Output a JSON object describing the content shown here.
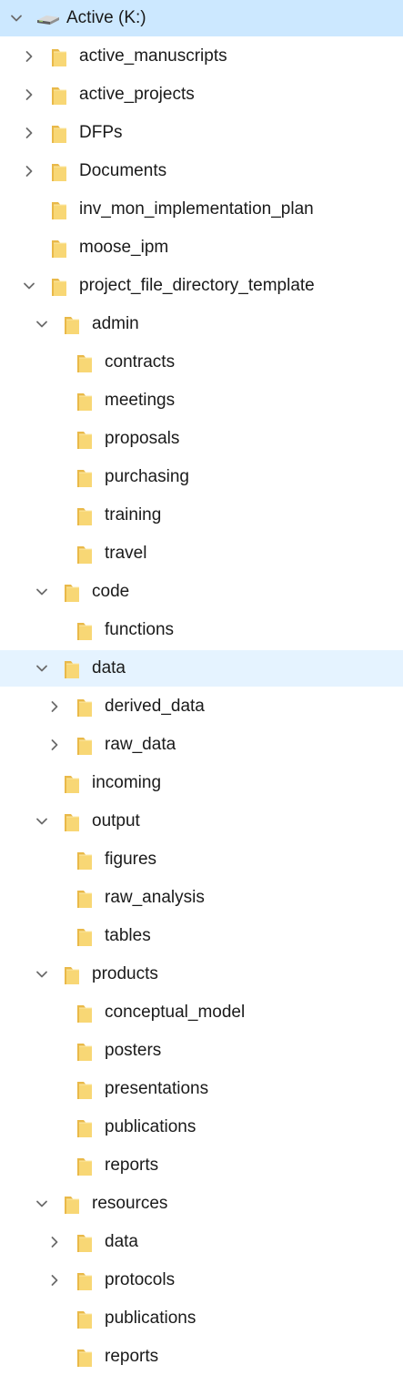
{
  "tree": [
    {
      "label": "Active (K:)",
      "icon": "drive-icon",
      "chevron": "expanded",
      "level": 0,
      "state": "selected"
    },
    {
      "label": "active_manuscripts",
      "icon": "folder-icon",
      "chevron": "collapsed",
      "level": 1
    },
    {
      "label": "active_projects",
      "icon": "folder-icon",
      "chevron": "collapsed",
      "level": 1
    },
    {
      "label": "DFPs",
      "icon": "folder-icon",
      "chevron": "collapsed",
      "level": 1
    },
    {
      "label": "Documents",
      "icon": "folder-icon",
      "chevron": "collapsed",
      "level": 1
    },
    {
      "label": "inv_mon_implementation_plan",
      "icon": "folder-icon",
      "chevron": "none",
      "level": 1
    },
    {
      "label": "moose_ipm",
      "icon": "folder-icon",
      "chevron": "none",
      "level": 1
    },
    {
      "label": "project_file_directory_template",
      "icon": "folder-icon",
      "chevron": "expanded",
      "level": 1
    },
    {
      "label": "admin",
      "icon": "folder-icon",
      "chevron": "expanded",
      "level": 2
    },
    {
      "label": "contracts",
      "icon": "folder-icon",
      "chevron": "none",
      "level": 3
    },
    {
      "label": "meetings",
      "icon": "folder-icon",
      "chevron": "none",
      "level": 3
    },
    {
      "label": "proposals",
      "icon": "folder-icon",
      "chevron": "none",
      "level": 3
    },
    {
      "label": "purchasing",
      "icon": "folder-icon",
      "chevron": "none",
      "level": 3
    },
    {
      "label": "training",
      "icon": "folder-icon",
      "chevron": "none",
      "level": 3
    },
    {
      "label": "travel",
      "icon": "folder-icon",
      "chevron": "none",
      "level": 3
    },
    {
      "label": "code",
      "icon": "folder-icon",
      "chevron": "expanded",
      "level": 2
    },
    {
      "label": "functions",
      "icon": "folder-icon",
      "chevron": "none",
      "level": 3
    },
    {
      "label": "data",
      "icon": "folder-icon",
      "chevron": "expanded",
      "level": 2,
      "state": "hovered"
    },
    {
      "label": "derived_data",
      "icon": "folder-icon",
      "chevron": "collapsed",
      "level": 3
    },
    {
      "label": "raw_data",
      "icon": "folder-icon",
      "chevron": "collapsed",
      "level": 3
    },
    {
      "label": "incoming",
      "icon": "folder-icon",
      "chevron": "none",
      "level": 2
    },
    {
      "label": "output",
      "icon": "folder-icon",
      "chevron": "expanded",
      "level": 2
    },
    {
      "label": "figures",
      "icon": "folder-icon",
      "chevron": "none",
      "level": 3
    },
    {
      "label": "raw_analysis",
      "icon": "folder-icon",
      "chevron": "none",
      "level": 3
    },
    {
      "label": "tables",
      "icon": "folder-icon",
      "chevron": "none",
      "level": 3
    },
    {
      "label": "products",
      "icon": "folder-icon",
      "chevron": "expanded",
      "level": 2
    },
    {
      "label": "conceptual_model",
      "icon": "folder-icon",
      "chevron": "none",
      "level": 3
    },
    {
      "label": "posters",
      "icon": "folder-icon",
      "chevron": "none",
      "level": 3
    },
    {
      "label": "presentations",
      "icon": "folder-icon",
      "chevron": "none",
      "level": 3
    },
    {
      "label": "publications",
      "icon": "folder-icon",
      "chevron": "none",
      "level": 3
    },
    {
      "label": "reports",
      "icon": "folder-icon",
      "chevron": "none",
      "level": 3
    },
    {
      "label": "resources",
      "icon": "folder-icon",
      "chevron": "expanded",
      "level": 2
    },
    {
      "label": "data",
      "icon": "folder-icon",
      "chevron": "collapsed",
      "level": 3
    },
    {
      "label": "protocols",
      "icon": "folder-icon",
      "chevron": "collapsed",
      "level": 3
    },
    {
      "label": "publications",
      "icon": "folder-icon",
      "chevron": "none",
      "level": 3
    },
    {
      "label": "reports",
      "icon": "folder-icon",
      "chevron": "none",
      "level": 3
    }
  ],
  "colors": {
    "selected_bg": "#cce8ff",
    "hovered_bg": "#e5f3ff",
    "folder_body": "#f8d775",
    "folder_back": "#e9b949",
    "chevron": "#6b6b6b"
  }
}
